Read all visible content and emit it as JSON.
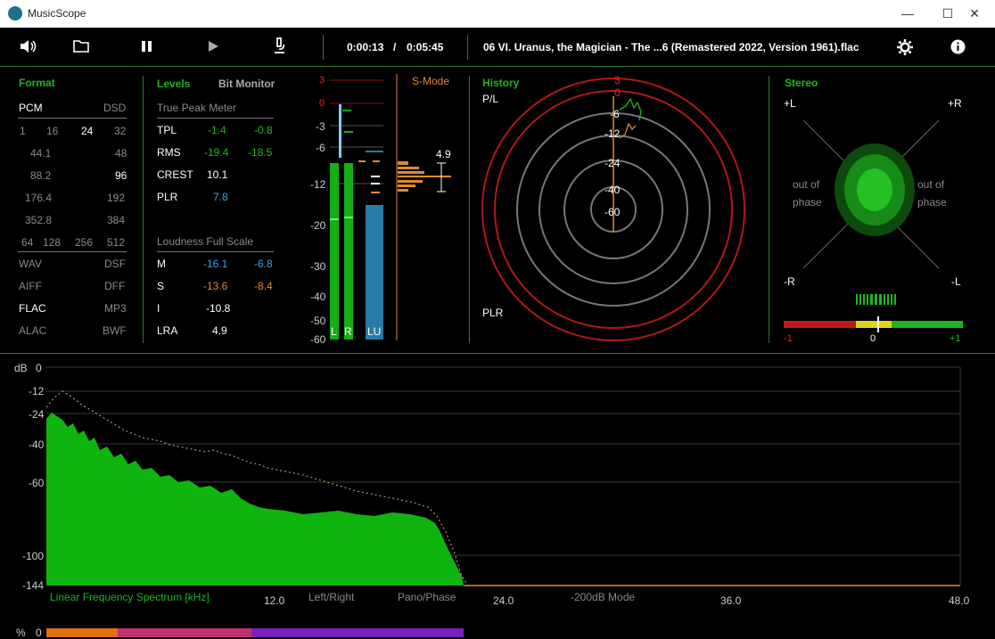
{
  "window": {
    "title": "MusicScope",
    "minimize": "—",
    "maximize": "☐",
    "close": "✕"
  },
  "toolbar": {
    "elapsed": "0:00:13",
    "slash": "/",
    "total": "0:05:45",
    "file": "06 VI. Uranus, the Magician - The ...6 (Remastered 2022, Version 1961).flac"
  },
  "format": {
    "header": "Format",
    "row1": [
      "PCM",
      "DSD"
    ],
    "bits": [
      "1",
      "16",
      "24",
      "32"
    ],
    "rates": [
      [
        "44.1",
        "48"
      ],
      [
        "88.2",
        "96"
      ],
      [
        "176.4",
        "192"
      ],
      [
        "352.8",
        "384"
      ]
    ],
    "dsd": [
      "64",
      "128",
      "256",
      "512"
    ],
    "files": [
      [
        "WAV",
        "DSF"
      ],
      [
        "AIFF",
        "DFF"
      ],
      [
        "FLAC",
        "MP3"
      ],
      [
        "ALAC",
        "BWF"
      ]
    ]
  },
  "levels": {
    "header": "Levels",
    "tab2": "Bit Monitor",
    "tp_title": "True Peak Meter",
    "tpl": {
      "label": "TPL",
      "l": "-1.4",
      "r": "-0.8"
    },
    "rms": {
      "label": "RMS",
      "l": "-19.4",
      "r": "-18.5"
    },
    "crest": {
      "label": "CREST",
      "v": "10.1"
    },
    "plr": {
      "label": "PLR",
      "v": "7.8"
    },
    "lfs_title": "Loudness Full Scale",
    "m": {
      "label": "M",
      "a": "-16.1",
      "b": "-6.8"
    },
    "s": {
      "label": "S",
      "a": "-13.6",
      "b": "-8.4"
    },
    "i": {
      "label": "I",
      "v": "-10.8"
    },
    "lra": {
      "label": "LRA",
      "v": "4.9"
    }
  },
  "meter": {
    "ticks": [
      "3",
      "0",
      "-3",
      "-6",
      "-12",
      "-20",
      "-30",
      "-40",
      "-50",
      "-60"
    ],
    "smode": "S-Mode",
    "hist_value": "4.9",
    "bars": [
      "L",
      "R",
      "LU"
    ]
  },
  "history": {
    "header": "History",
    "pl": "P/L",
    "plr": "PLR",
    "rings": [
      "3",
      "0",
      "-6",
      "-12",
      "-24",
      "-40",
      "-60"
    ]
  },
  "stereo": {
    "header": "Stereo",
    "pl": "+L",
    "pr": "+R",
    "ml": "-L",
    "mr": "-R",
    "oop_left": [
      "out of",
      "phase"
    ],
    "oop_right": [
      "out of",
      "phase"
    ],
    "bal": [
      "-1",
      "0",
      "+1"
    ]
  },
  "spectrum": {
    "db": "dB",
    "yticks": [
      "0",
      "-12",
      "-24",
      "-40",
      "-60",
      "-100",
      "-144"
    ],
    "title": "Linear Frequency Spectrum [kHz]",
    "xticks": [
      "12.0",
      "24.0",
      "36.0",
      "48.0"
    ],
    "mode1": "Left/Right",
    "mode2": "Pano/Phase",
    "mode3": "-200dB Mode"
  },
  "percent": {
    "label": "%",
    "value": "0"
  },
  "colors": {
    "green": "#1fb51f",
    "red": "#c01818",
    "orange": "#e08a30",
    "blue": "#2a7ca8"
  }
}
